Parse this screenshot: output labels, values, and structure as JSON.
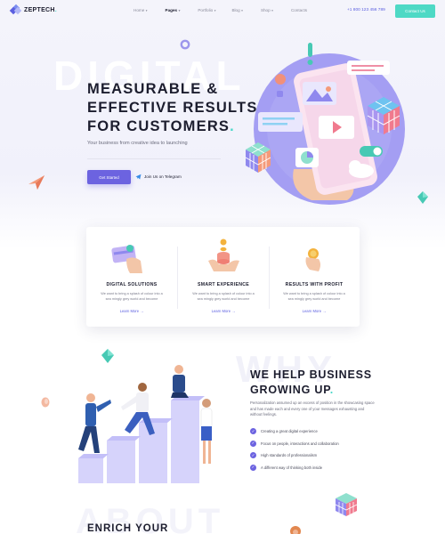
{
  "brand": {
    "name": "ZEPTECH",
    "dot": ".",
    "accent": "#4ad8c9",
    "primary": "#6c63e0"
  },
  "nav": {
    "items": [
      {
        "label": "Home",
        "caret": true,
        "active": false
      },
      {
        "label": "Pages",
        "caret": true,
        "active": true
      },
      {
        "label": "Portfolio",
        "caret": true,
        "active": false
      },
      {
        "label": "Blog",
        "caret": true,
        "active": false
      },
      {
        "label": "Shop",
        "caret": true,
        "active": false
      },
      {
        "label": "Contacts",
        "caret": false,
        "active": false
      }
    ],
    "phone": "+1 800 123 456 789",
    "contact_button": "Contact Us"
  },
  "hero": {
    "background_word": "DIGITAL",
    "title_line1": "MEASURABLE &",
    "title_line2": "EFFECTIVE RESULTS",
    "title_line3": "FOR CUSTOMERS",
    "title_dot": ".",
    "subtitle": "Your business from creative idea to launching",
    "primary_button": "Get Started",
    "telegram_link": "Join Us on Telegram"
  },
  "features": [
    {
      "icon": "credit-card-hand-icon",
      "title": "DIGITAL SOLUTIONS",
      "desc": "We want to bring a splash of colour into a sea mingly grey world and become",
      "link": "Learn More"
    },
    {
      "icon": "coin-stack-hand-icon",
      "title": "SMART EXPERIENCE",
      "desc": "We want to bring a splash of colour into a sea mingly grey world and become",
      "link": "Learn More"
    },
    {
      "icon": "coin-fingers-icon",
      "title": "RESULTS WITH PROFIT",
      "desc": "We want to bring a splash of colour into a sea mingly grey world and become",
      "link": "Learn More"
    }
  ],
  "why": {
    "background_word": "WHY",
    "title_line1": "WE HELP BUSINESS",
    "title_line2": "GROWING UP",
    "title_dot": ".",
    "description": "Personalization assumed up an excess of position in the showcasing space and has made each and every one of your messages exhausting and without feelings.",
    "list": [
      "Creating a great digital experience",
      "Focus on people, interactions and collaboration",
      "High standards of professionalism",
      "A different way of thinking both inside"
    ]
  },
  "about": {
    "background_word": "ABOUT",
    "title": "ENRICH YOUR"
  }
}
